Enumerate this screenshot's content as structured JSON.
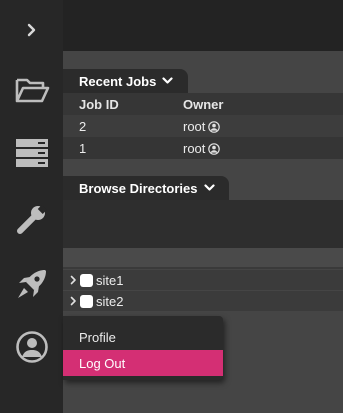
{
  "sidebar": {
    "items": [
      {
        "name": "expand",
        "icon": "chevron-right-icon"
      },
      {
        "name": "files",
        "icon": "folder-icon"
      },
      {
        "name": "storage",
        "icon": "server-icon"
      },
      {
        "name": "tools",
        "icon": "wrench-icon"
      },
      {
        "name": "launch",
        "icon": "rocket-icon"
      },
      {
        "name": "account",
        "icon": "user-circle-icon"
      }
    ]
  },
  "recent_jobs": {
    "title": "Recent Jobs",
    "columns": [
      "Job ID",
      "Owner"
    ],
    "rows": [
      {
        "job_id": "2",
        "owner": "root"
      },
      {
        "job_id": "1",
        "owner": "root"
      }
    ]
  },
  "browse": {
    "title": "Browse Directories",
    "sites": [
      {
        "label": "site1"
      },
      {
        "label": "site2"
      }
    ]
  },
  "user_menu": {
    "items": [
      {
        "label": "Profile"
      },
      {
        "label": "Log Out"
      }
    ]
  },
  "colors": {
    "accent": "#d42f74",
    "sidebar": "#272727",
    "background": "#454545"
  }
}
